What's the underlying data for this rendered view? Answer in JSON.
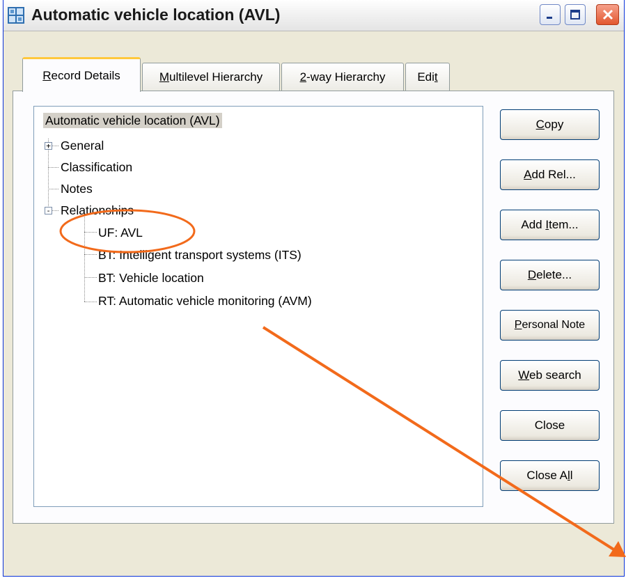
{
  "window": {
    "title": "Automatic vehicle location (AVL)",
    "app_icon": "grid-app-icon",
    "controls": [
      "minimize",
      "maximize",
      "close"
    ],
    "accent": "#0831d9"
  },
  "tabs": [
    {
      "label": "Record Details",
      "mnemonic": "R",
      "active": true
    },
    {
      "label": "Multilevel Hierarchy",
      "mnemonic": "M",
      "active": false
    },
    {
      "label": "2-way Hierarchy",
      "mnemonic": "2",
      "active": false
    },
    {
      "label": "Edit",
      "mnemonic": "t",
      "active": false
    }
  ],
  "tree": {
    "root": "Automatic vehicle location (AVL)",
    "items": [
      {
        "label": "General",
        "expander": "+"
      },
      {
        "label": "Classification"
      },
      {
        "label": "Notes"
      },
      {
        "label": "Relationships",
        "expander": "-"
      }
    ],
    "relationships": [
      {
        "label": "UF: AVL"
      },
      {
        "label": "BT: Intelligent transport systems (ITS)"
      },
      {
        "label": "BT: Vehicle location"
      },
      {
        "label": "RT: Automatic vehicle monitoring (AVM)"
      }
    ]
  },
  "buttons": [
    {
      "label": "Copy",
      "mnemonic": "C"
    },
    {
      "label": "Add Rel...",
      "mnemonic": "A"
    },
    {
      "label": "Add Item...",
      "mnemonic": "I"
    },
    {
      "label": "Delete...",
      "mnemonic": "D"
    },
    {
      "label": "Personal Note",
      "mnemonic": "P"
    },
    {
      "label": "Web search",
      "mnemonic": "W"
    },
    {
      "label": "Close",
      "mnemonic": ""
    },
    {
      "label": "Close All",
      "mnemonic": "l"
    }
  ],
  "annotation": {
    "color": "#f26a1b",
    "shapes": [
      "ellipse-highlight",
      "arrow"
    ]
  }
}
